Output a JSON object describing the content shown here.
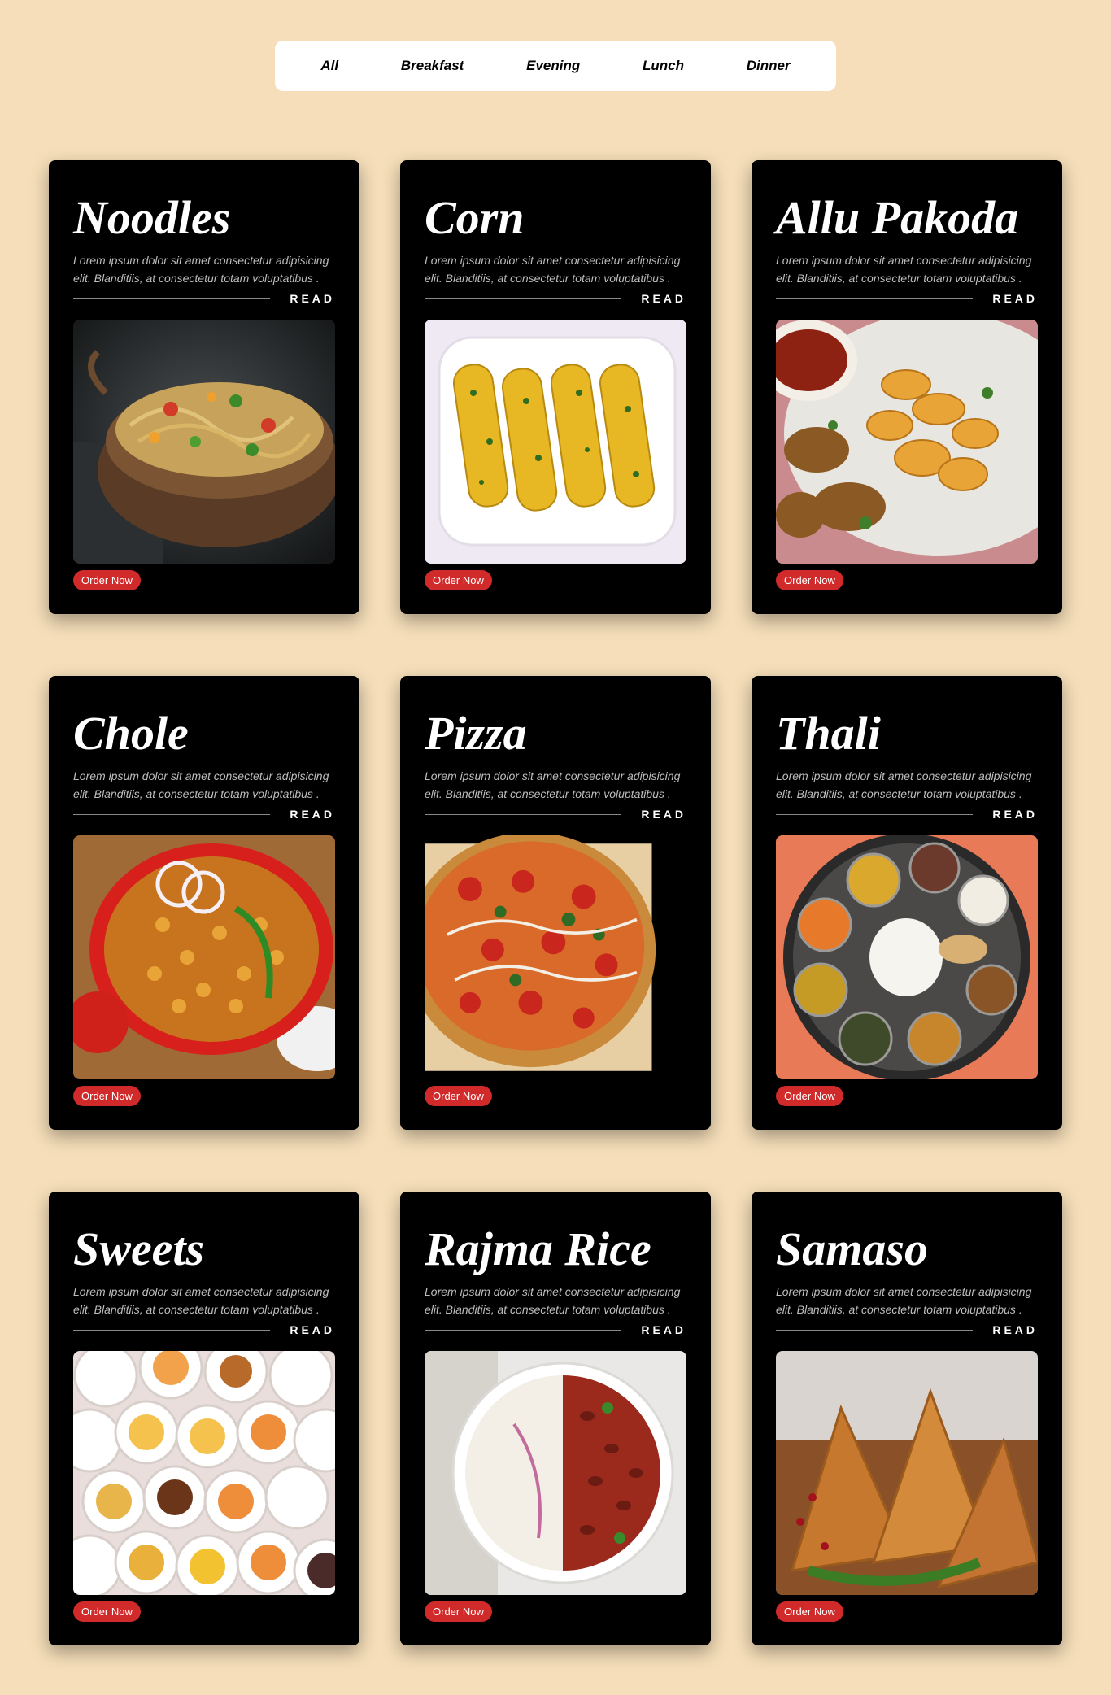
{
  "filters": [
    "All",
    "Breakfast",
    "Evening",
    "Lunch",
    "Dinner"
  ],
  "card_common": {
    "description": "Lorem ipsum dolor sit amet consectetur adipisicing elit. Blanditiis, at consectetur totam voluptatibus .",
    "read_label": "READ",
    "order_label": "Order Now"
  },
  "cards": [
    {
      "title": "Noodles",
      "image": "noodles-photo"
    },
    {
      "title": "Corn",
      "image": "corn-photo"
    },
    {
      "title": "Allu Pakoda",
      "image": "allu-pakoda-photo"
    },
    {
      "title": "Chole",
      "image": "chole-photo"
    },
    {
      "title": "Pizza",
      "image": "pizza-photo"
    },
    {
      "title": "Thali",
      "image": "thali-photo"
    },
    {
      "title": "Sweets",
      "image": "sweets-photo"
    },
    {
      "title": "Rajma Rice",
      "image": "rajma-rice-photo"
    },
    {
      "title": "Samaso",
      "image": "samaso-photo"
    }
  ],
  "colors": {
    "page_background": "#f5deb9",
    "card_background": "#000000",
    "order_button": "#d12a2a"
  }
}
